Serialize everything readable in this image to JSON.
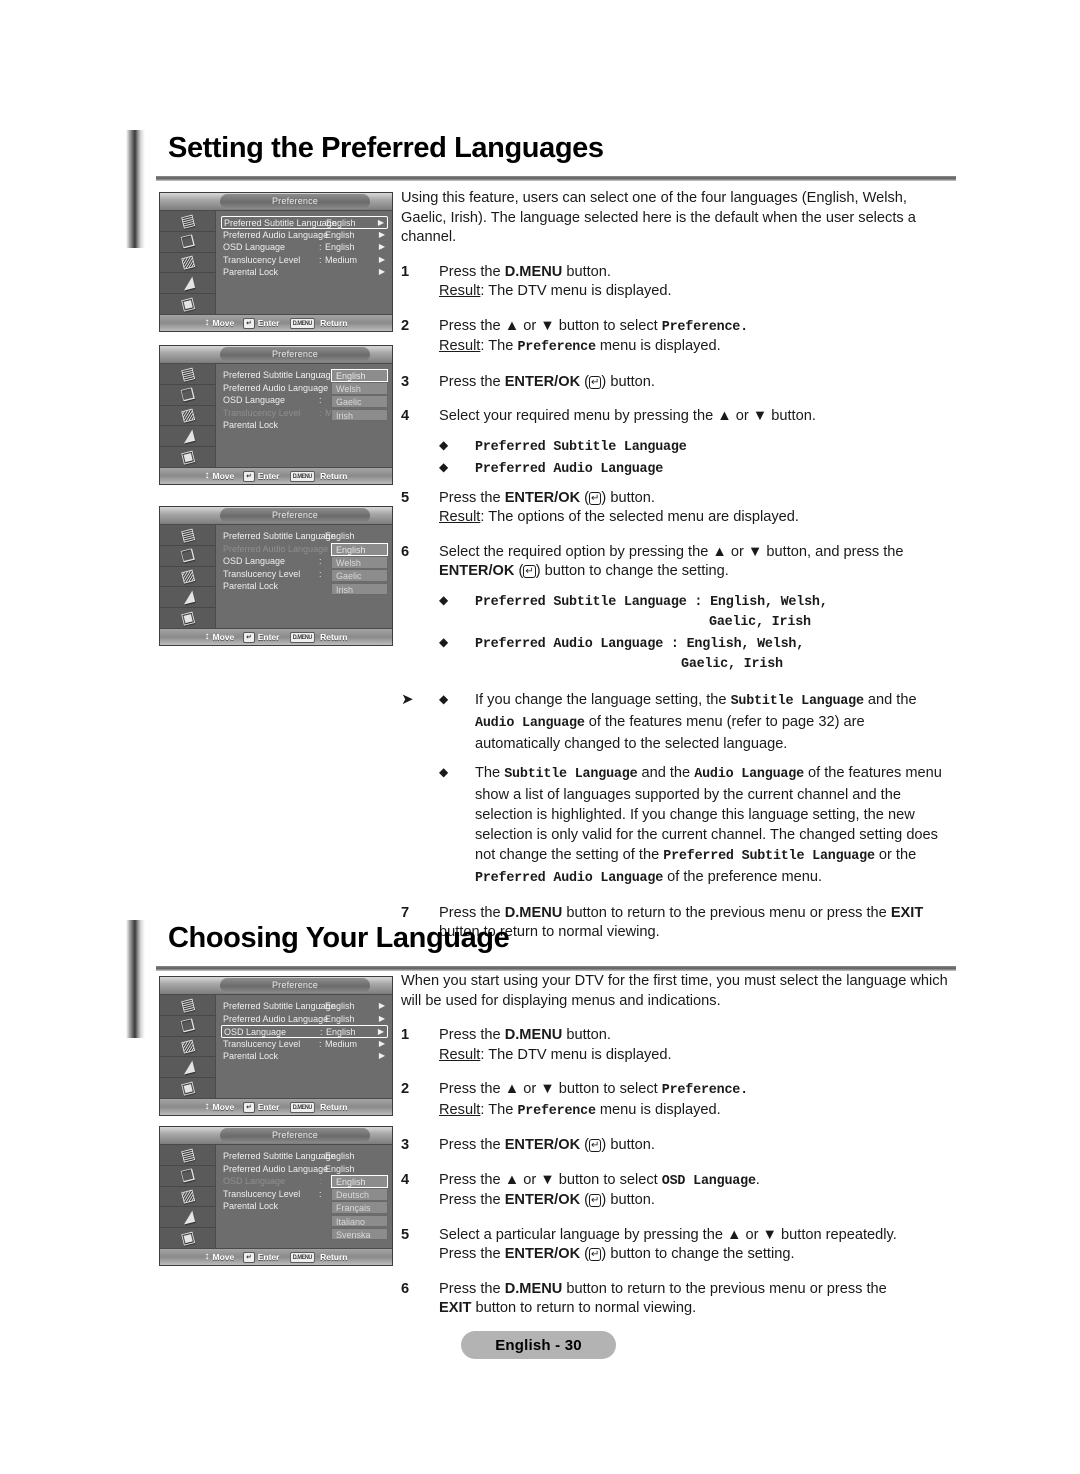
{
  "page": {
    "footer_label": "English - 30"
  },
  "sections": [
    {
      "title": "Setting the Preferred Languages",
      "intro": "Using this feature, users can select one of the four languages (English, Welsh, Gaelic, Irish). The language selected here is the default when the user selects a channel."
    },
    {
      "title": "Choosing Your Language",
      "intro": "When you start using your DTV for the first time, you must select the language which will be used for displaying menus and indications."
    }
  ],
  "steps1": {
    "s1_num": "1",
    "s1_text_a": "Press the ",
    "s1_bold": "D.MENU",
    "s1_text_b": " button.",
    "s1_result_label": "Result",
    "s1_result_text": ": The DTV menu is displayed.",
    "s2_num": "2",
    "s2_text_a": "Press the ▲ or ▼ button to select ",
    "s2_mono": "Preference.",
    "s2_result_label": "Result",
    "s2_result_a": ": The ",
    "s2_result_mono": "Preference",
    "s2_result_b": " menu is displayed.",
    "s3_num": "3",
    "s3_text_a": "Press the ",
    "s3_bold": "ENTER/OK",
    "s3_text_b": " ( ",
    "s3_key": "↵",
    "s3_text_c": " ) button.",
    "s4_num": "4",
    "s4_text": "Select your required menu by pressing the ▲ or ▼ button.",
    "s4_bullets": [
      "Preferred Subtitle Language",
      "Preferred Audio Language"
    ],
    "s5_num": "5",
    "s5_text_a": "Press the ",
    "s5_bold": "ENTER/OK",
    "s5_text_c": " ) button.",
    "s5_result_label": "Result",
    "s5_result_text": ": The options of the selected menu are displayed.",
    "s6_num": "6",
    "s6_text_a": "Select the required option by pressing the ▲ or ▼ button, and press the ",
    "s6_bold": "ENTER/OK",
    "s6_text_c": " ) button to change the setting.",
    "s6_bullet1_main": "Preferred Subtitle Language : English, Welsh,",
    "s6_bullet1_cont": "Gaelic, Irish",
    "s6_bullet2_main": "Preferred Audio Language : English, Welsh,",
    "s6_bullet2_cont": "Gaelic, Irish",
    "note1_a": "If you change the language setting, the ",
    "note1_mono1": "Subtitle Language",
    "note1_b": " and the ",
    "note1_mono2": "Audio Language",
    "note1_c": " of the features menu (refer to page 32) are automatically changed to the selected language.",
    "note2_a": "The ",
    "note2_mono1": "Subtitle Language",
    "note2_b": " and the ",
    "note2_mono2": "Audio Language",
    "note2_c": " of the features menu show a list of languages supported by the current channel and the selection is highlighted. If you change this language setting, the new selection is only valid for the current channel. The changed setting does not change the setting of the ",
    "note2_mono3": "Preferred Subtitle Language",
    "note2_d": " or the ",
    "note2_mono4": "Preferred Audio Language",
    "note2_e": " of the preference menu.",
    "s7_num": "7",
    "s7_text_a": "Press the ",
    "s7_bold1": "D.MENU",
    "s7_text_b": " button to return to the previous menu or press the ",
    "s7_bold2": "EXIT",
    "s7_text_c": " button to return to normal viewing."
  },
  "steps2": {
    "s1_num": "1",
    "s1_text_a": "Press the ",
    "s1_bold": "D.MENU",
    "s1_text_b": " button.",
    "s1_result_label": "Result",
    "s1_result_text": ": The DTV menu is displayed.",
    "s2_num": "2",
    "s2_text_a": "Press the ▲ or ▼ button to select ",
    "s2_mono": "Preference.",
    "s2_result_label": "Result",
    "s2_result_a": ": The ",
    "s2_result_mono": "Preference",
    "s2_result_b": " menu is displayed.",
    "s3_num": "3",
    "s3_text_a": "Press the ",
    "s3_bold": "ENTER/OK",
    "s3_text_c": " ) button.",
    "s4_num": "4",
    "s4_text_a": "Press the ▲ or ▼ button to select ",
    "s4_mono": "OSD Language",
    "s4_text_b": ".",
    "s4_line2_a": "Press the ",
    "s4_line2_bold": "ENTER/OK",
    "s4_line2_c": " ) button.",
    "s5_num": "5",
    "s5_text": "Select a particular language by pressing the ▲ or ▼ button repeatedly.",
    "s5_line2_a": "Press the ",
    "s5_line2_bold": "ENTER/OK",
    "s5_line2_c": " ) button to change the setting.",
    "s6_num": "6",
    "s6_text_a": "Press the ",
    "s6_bold1": "D.MENU",
    "s6_text_b": " button to return to the previous menu or press the ",
    "s6_bold2": "EXIT",
    "s6_text_c": " button to return to normal viewing."
  },
  "osd": {
    "title": "Preference",
    "rows": [
      {
        "label": "Preferred Subtitle Language",
        "colon": ":",
        "value": "English"
      },
      {
        "label": "Preferred Audio Language",
        "colon": ":",
        "value": "English"
      },
      {
        "label": "OSD Language",
        "colon": ":",
        "value": "English"
      },
      {
        "label": "Translucency Level",
        "colon": ":",
        "value": "Medium"
      },
      {
        "label": "Parental Lock",
        "colon": "",
        "value": ""
      }
    ],
    "footer": {
      "move": "Move",
      "enter": "Enter",
      "return": "Return",
      "updown_icon": "↕",
      "enter_icon": "↵",
      "menu_icon": "D.MENU"
    },
    "language_options": [
      "English",
      "Welsh",
      "Gaelic",
      "Irish"
    ],
    "osd_language_options": [
      "English",
      "Deutsch",
      "Français",
      "Italiano",
      "Svenska"
    ],
    "icons": [
      "channel-icon",
      "picture-icon",
      "sound-icon",
      "setup-icon",
      "preference-icon"
    ],
    "icon_glyphs": [
      "▤",
      "❑",
      "▨",
      "◢",
      "▣"
    ]
  }
}
